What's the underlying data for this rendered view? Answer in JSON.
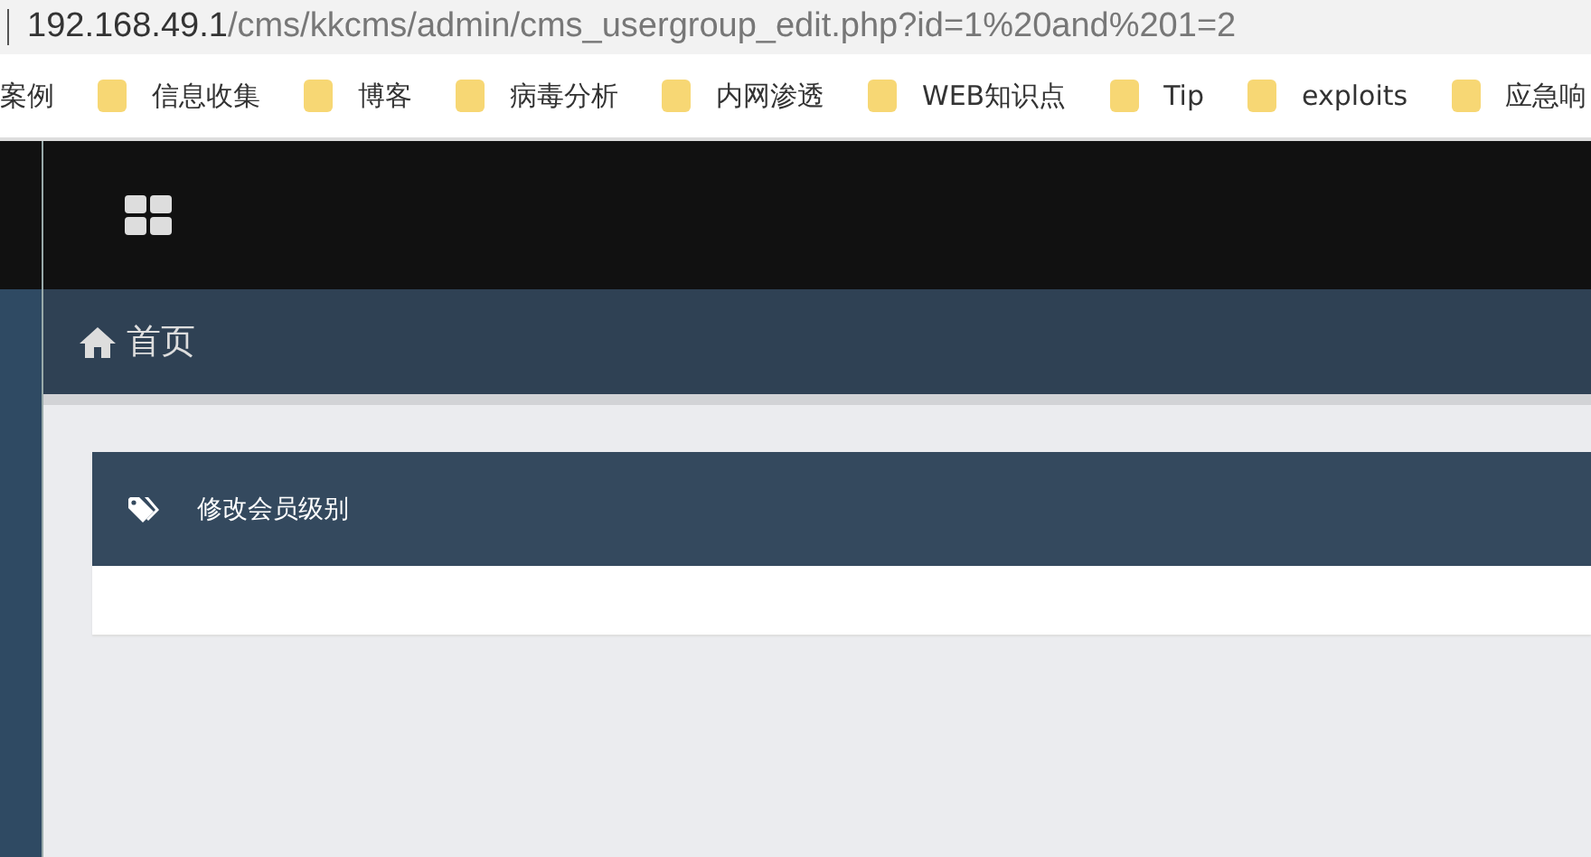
{
  "address_bar": {
    "host": "192.168.49.1",
    "path": "/cms/kkcms/admin/cms_usergroup_edit.php?id=1%20and%201=2"
  },
  "bookmarks": [
    {
      "label": "案例",
      "kind": "text"
    },
    {
      "label": "信息收集",
      "kind": "folder"
    },
    {
      "label": "博客",
      "kind": "folder"
    },
    {
      "label": "病毒分析",
      "kind": "folder"
    },
    {
      "label": "内网渗透",
      "kind": "folder"
    },
    {
      "label": "WEB知识点",
      "kind": "folder"
    },
    {
      "label": "Tip",
      "kind": "folder"
    },
    {
      "label": "exploits",
      "kind": "folder"
    },
    {
      "label": "应急响",
      "kind": "folder"
    }
  ],
  "breadcrumb": {
    "label": "首页"
  },
  "panel": {
    "title": "修改会员级别"
  }
}
